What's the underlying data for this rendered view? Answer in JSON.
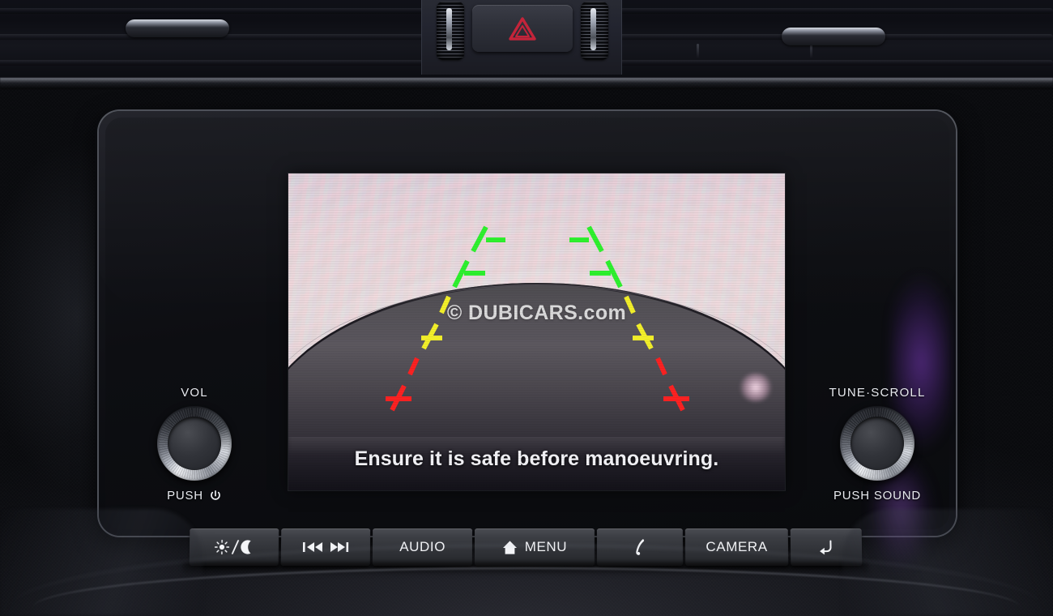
{
  "device": {
    "type": "car-infotainment-head-unit",
    "mode": "rear-view-camera"
  },
  "screen": {
    "warning_text": "Ensure it is safe before manoeuvring.",
    "watermark": "© DUBICARS.com",
    "guide_colors": {
      "green": "#2ef02e",
      "yellow": "#f2ef2a",
      "red": "#fb2222"
    },
    "guide_markers": [
      {
        "side": "left",
        "color": "green",
        "label": "far-distance-marker"
      },
      {
        "side": "left",
        "color": "green",
        "label": "mid-far-distance-marker"
      },
      {
        "side": "left",
        "color": "yellow",
        "label": "mid-distance-marker"
      },
      {
        "side": "left",
        "color": "red",
        "label": "near-distance-marker"
      },
      {
        "side": "right",
        "color": "green",
        "label": "far-distance-marker"
      },
      {
        "side": "right",
        "color": "green",
        "label": "mid-far-distance-marker"
      },
      {
        "side": "right",
        "color": "yellow",
        "label": "mid-distance-marker"
      },
      {
        "side": "right",
        "color": "red",
        "label": "near-distance-marker"
      }
    ]
  },
  "knobs": {
    "left": {
      "label": "VOL",
      "sub_label": "PUSH",
      "sub_icon": "power-icon"
    },
    "right": {
      "label": "TUNE·SCROLL",
      "sub_label": "PUSH SOUND",
      "sub_icon": "none"
    }
  },
  "hardware_buttons": [
    {
      "id": "display-brightness",
      "label": "",
      "icon": "sun-moon-icon"
    },
    {
      "id": "track-skip",
      "label": "",
      "icon": "prev-next-icon"
    },
    {
      "id": "audio",
      "label": "AUDIO",
      "icon": "none"
    },
    {
      "id": "menu",
      "label": "MENU",
      "icon": "home-icon"
    },
    {
      "id": "phone",
      "label": "",
      "icon": "phone-icon"
    },
    {
      "id": "camera",
      "label": "CAMERA",
      "icon": "none"
    },
    {
      "id": "back",
      "label": "",
      "icon": "back-arrow-icon"
    }
  ],
  "dash": {
    "hazard_button": {
      "icon": "hazard-triangle-icon",
      "color": "#c4243a"
    },
    "vents": {
      "left_slider": "vent-direction-slider",
      "right_slider": "vent-direction-slider"
    }
  }
}
